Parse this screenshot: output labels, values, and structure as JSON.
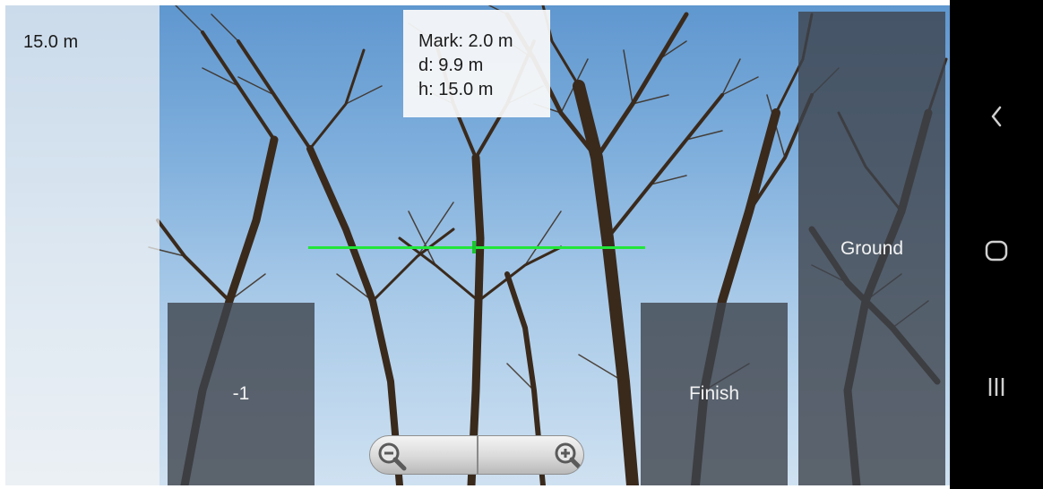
{
  "height_readout": "15.0 m",
  "info_box": {
    "mark": "Mark: 2.0 m",
    "distance": "d: 9.9 m",
    "height": "h: 15.0 m"
  },
  "buttons": {
    "minus": "-1",
    "finish": "Finish",
    "ground": "Ground"
  },
  "zoom": {
    "out_icon": "zoom-out-icon",
    "in_icon": "zoom-in-icon"
  },
  "nav": {
    "back_icon": "back-icon",
    "home_icon": "home-icon",
    "recents_icon": "recents-icon"
  },
  "colors": {
    "horizon_line": "#22e63a",
    "button_bg": "#3e444c"
  }
}
